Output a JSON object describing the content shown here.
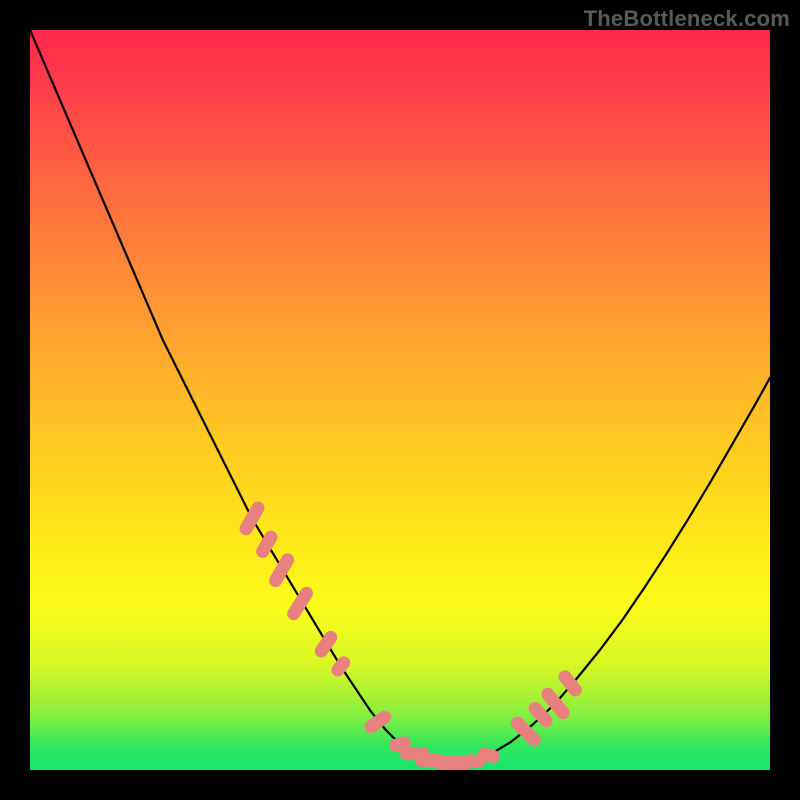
{
  "watermark": "TheBottleneck.com",
  "colors": {
    "curve_stroke": "#000000",
    "marker_fill": "#e98080",
    "background_black": "#000000",
    "gradient_top": "#ff2a4b",
    "gradient_bottom": "#17e66e"
  },
  "chart_data": {
    "type": "line",
    "title": "",
    "xlabel": "",
    "ylabel": "",
    "xlim": [
      0,
      100
    ],
    "ylim": [
      0,
      100
    ],
    "grid": false,
    "legend": false,
    "series": [
      {
        "name": "bottleneck-curve",
        "x": [
          0,
          3,
          6,
          9,
          12,
          15,
          18,
          21,
          24,
          27,
          30,
          33,
          36,
          39,
          42,
          44,
          46,
          48,
          50,
          52,
          54,
          56,
          58,
          60,
          62,
          65,
          68,
          71,
          74,
          77,
          80,
          83,
          86,
          89,
          92,
          95,
          98,
          100
        ],
        "y": [
          100,
          93,
          86,
          79,
          72,
          65,
          58,
          52,
          46,
          40,
          34,
          29,
          24,
          19,
          14,
          11,
          8,
          5.5,
          3.5,
          2.2,
          1.3,
          1,
          1,
          1.2,
          2,
          3.8,
          6.2,
          9,
          12.5,
          16.2,
          20.2,
          24.6,
          29.2,
          34,
          39,
          44.2,
          49.4,
          53
        ]
      }
    ],
    "markers": [
      {
        "x": 30,
        "y": 34,
        "len": 5,
        "angle": -60
      },
      {
        "x": 32,
        "y": 30.5,
        "len": 4,
        "angle": -60
      },
      {
        "x": 34,
        "y": 27,
        "len": 5,
        "angle": -60
      },
      {
        "x": 36.5,
        "y": 22.5,
        "len": 5,
        "angle": -58
      },
      {
        "x": 40,
        "y": 17,
        "len": 4,
        "angle": -55
      },
      {
        "x": 42,
        "y": 14,
        "len": 3,
        "angle": -52
      },
      {
        "x": 47,
        "y": 6.5,
        "len": 4,
        "angle": -35
      },
      {
        "x": 50,
        "y": 3.5,
        "len": 3,
        "angle": -15
      },
      {
        "x": 52,
        "y": 2.2,
        "len": 4,
        "angle": 0
      },
      {
        "x": 54,
        "y": 1.3,
        "len": 4,
        "angle": 0
      },
      {
        "x": 56,
        "y": 1,
        "len": 3,
        "angle": 0
      },
      {
        "x": 58,
        "y": 1,
        "len": 4,
        "angle": 0
      },
      {
        "x": 60,
        "y": 1.2,
        "len": 3,
        "angle": 5
      },
      {
        "x": 62,
        "y": 2,
        "len": 3,
        "angle": 15
      },
      {
        "x": 67,
        "y": 5.2,
        "len": 5,
        "angle": 45
      },
      {
        "x": 69,
        "y": 7.5,
        "len": 4,
        "angle": 48
      },
      {
        "x": 71,
        "y": 9,
        "len": 5,
        "angle": 50
      },
      {
        "x": 73,
        "y": 11.7,
        "len": 4,
        "angle": 52
      }
    ]
  }
}
